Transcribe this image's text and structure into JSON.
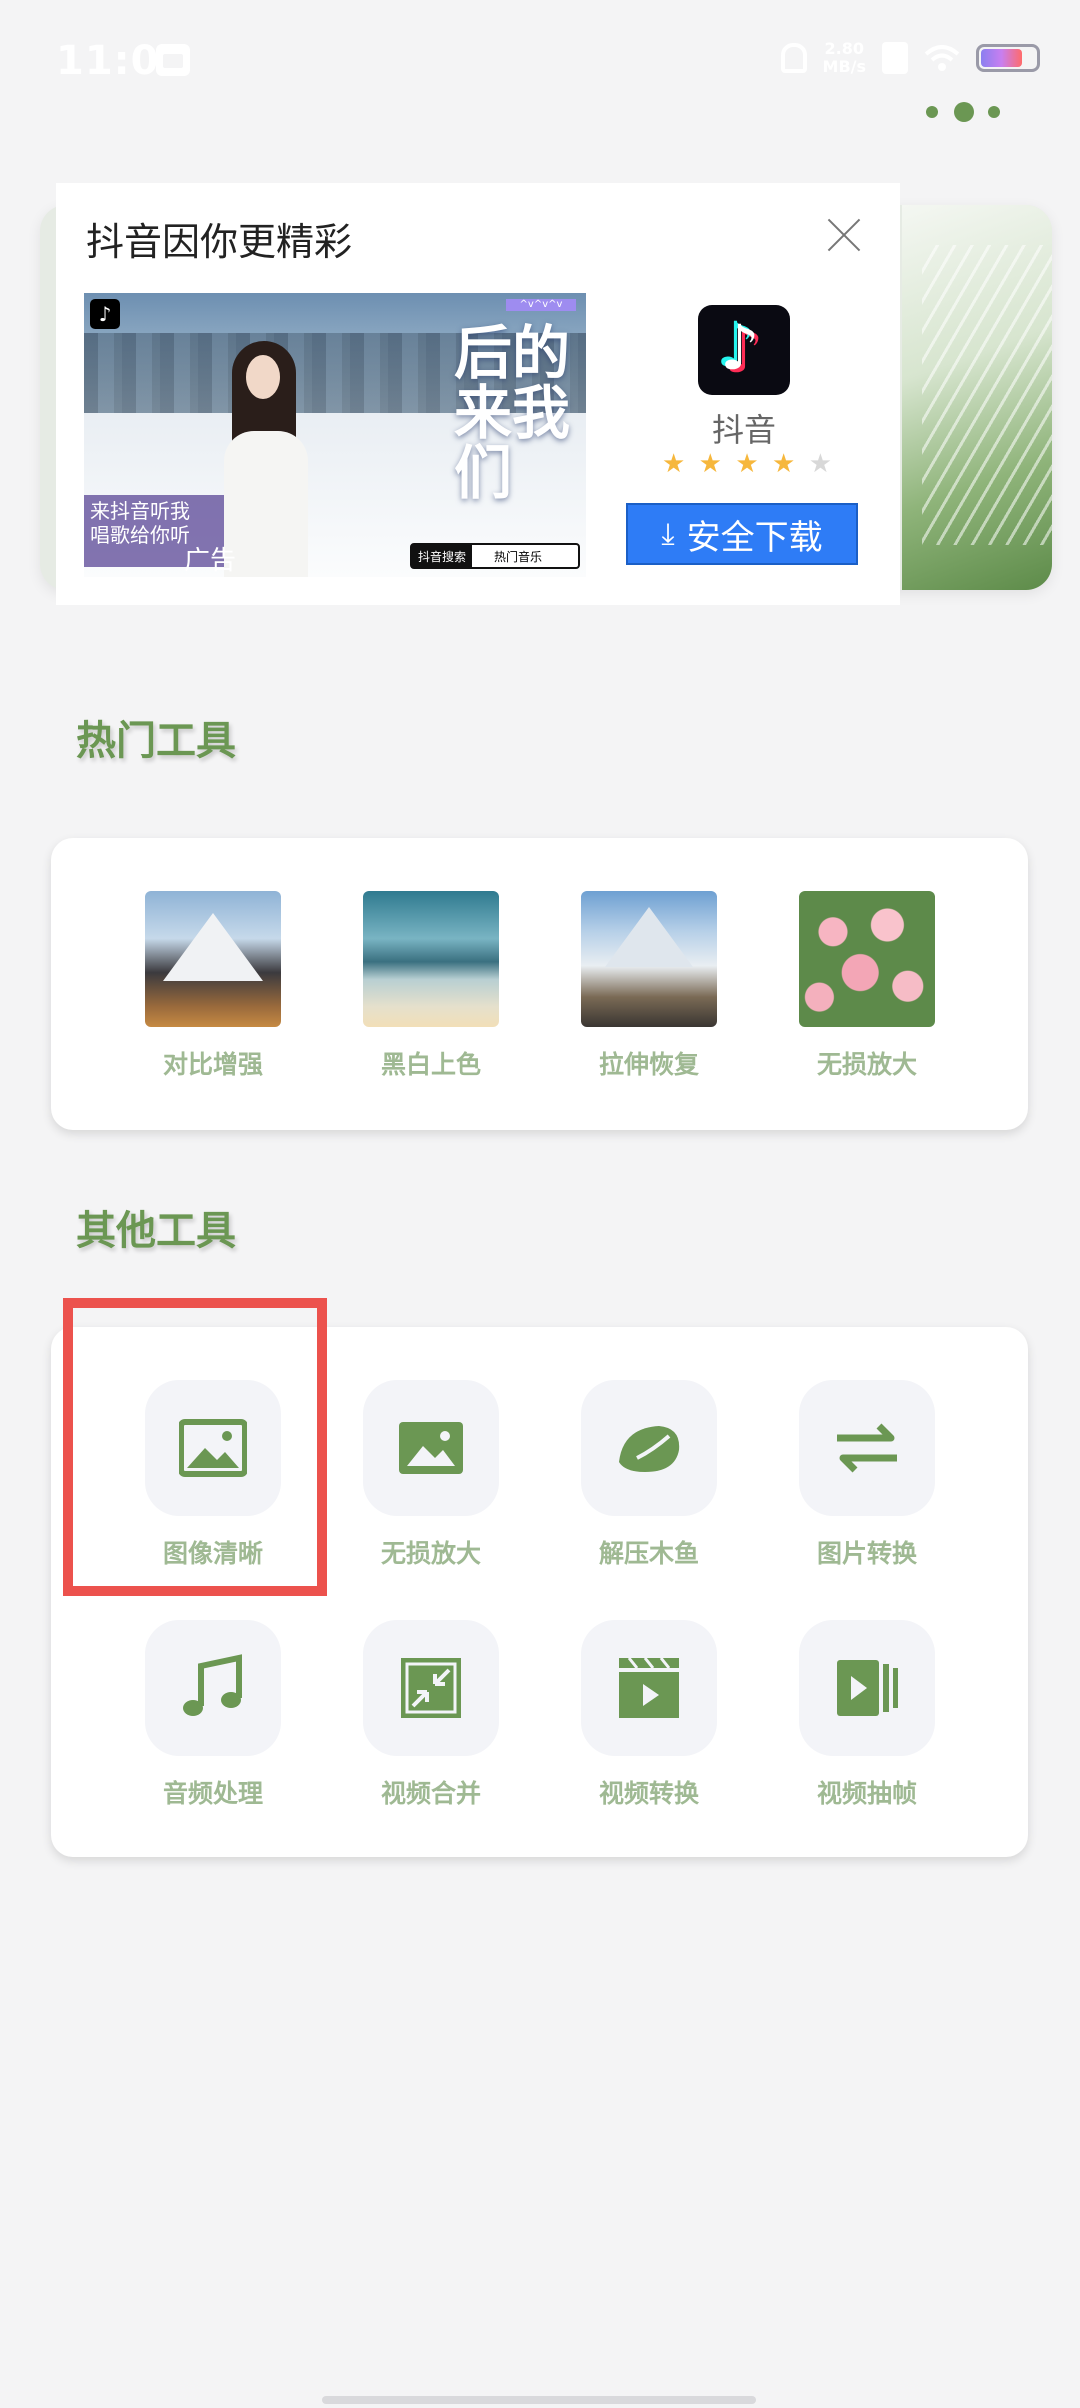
{
  "status_bar": {
    "time": "11:04",
    "net_speed_value": "2.80",
    "net_speed_unit": "MB/s",
    "battery_icon": "battery-icon"
  },
  "ad": {
    "title": "抖音因你更精彩",
    "image_poem": "后的\n来我\n们",
    "image_caption": "来抖音听我\n唱歌给你听",
    "image_label": "广告",
    "search_left": "抖音搜索",
    "search_right": "热门音乐",
    "app_name": "抖音",
    "rating_stars": 4,
    "download_label": "安全下载"
  },
  "sections": {
    "popular_title": "热门工具",
    "other_title": "其他工具"
  },
  "popular_tools": [
    {
      "label": "对比增强",
      "thumb": "snowy-mountain"
    },
    {
      "label": "黑白上色",
      "thumb": "lake-clouds"
    },
    {
      "label": "拉伸恢复",
      "thumb": "mountain-road"
    },
    {
      "label": "无损放大",
      "thumb": "pink-roses"
    }
  ],
  "other_tools": [
    {
      "label": "图像清晰",
      "icon": "image-icon"
    },
    {
      "label": "无损放大",
      "icon": "image-icon"
    },
    {
      "label": "解压木鱼",
      "icon": "wooden-fish-icon"
    },
    {
      "label": "图片转换",
      "icon": "swap-arrows-icon"
    },
    {
      "label": "音频处理",
      "icon": "music-note-icon"
    },
    {
      "label": "视频合并",
      "icon": "merge-icon"
    },
    {
      "label": "视频转换",
      "icon": "video-clapper-icon"
    },
    {
      "label": "视频抽帧",
      "icon": "video-frames-icon"
    }
  ],
  "colors": {
    "accent": "#6b9753",
    "label": "#9fb993",
    "highlight": "#ec524d",
    "download": "#2e7cf6"
  }
}
